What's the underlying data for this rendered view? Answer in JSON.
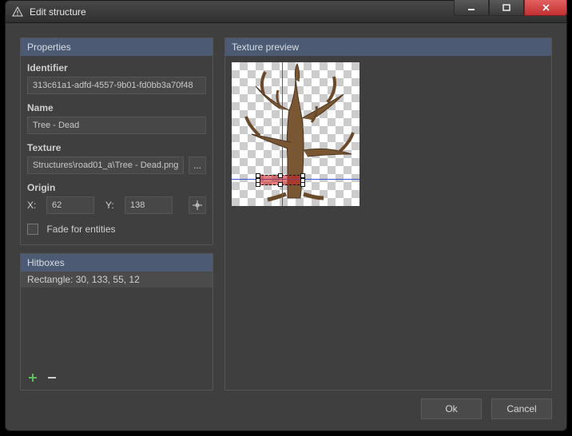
{
  "window": {
    "title": "Edit structure"
  },
  "properties": {
    "panel_title": "Properties",
    "identifier_label": "Identifier",
    "identifier_value": "313c61a1-adfd-4557-9b01-fd0bb3a70f48",
    "name_label": "Name",
    "name_value": "Tree - Dead",
    "texture_label": "Texture",
    "texture_value": "Structures\\road01_a\\Tree - Dead.png",
    "texture_browse": "...",
    "origin_label": "Origin",
    "origin_x_label": "X:",
    "origin_x_value": "62",
    "origin_y_label": "Y:",
    "origin_y_value": "138",
    "fade_label": "Fade for entities",
    "fade_checked": false
  },
  "hitboxes": {
    "panel_title": "Hitboxes",
    "items": [
      {
        "label": "Rectangle: 30, 133, 55, 12"
      }
    ]
  },
  "preview": {
    "panel_title": "Texture preview"
  },
  "buttons": {
    "ok": "Ok",
    "cancel": "Cancel"
  }
}
